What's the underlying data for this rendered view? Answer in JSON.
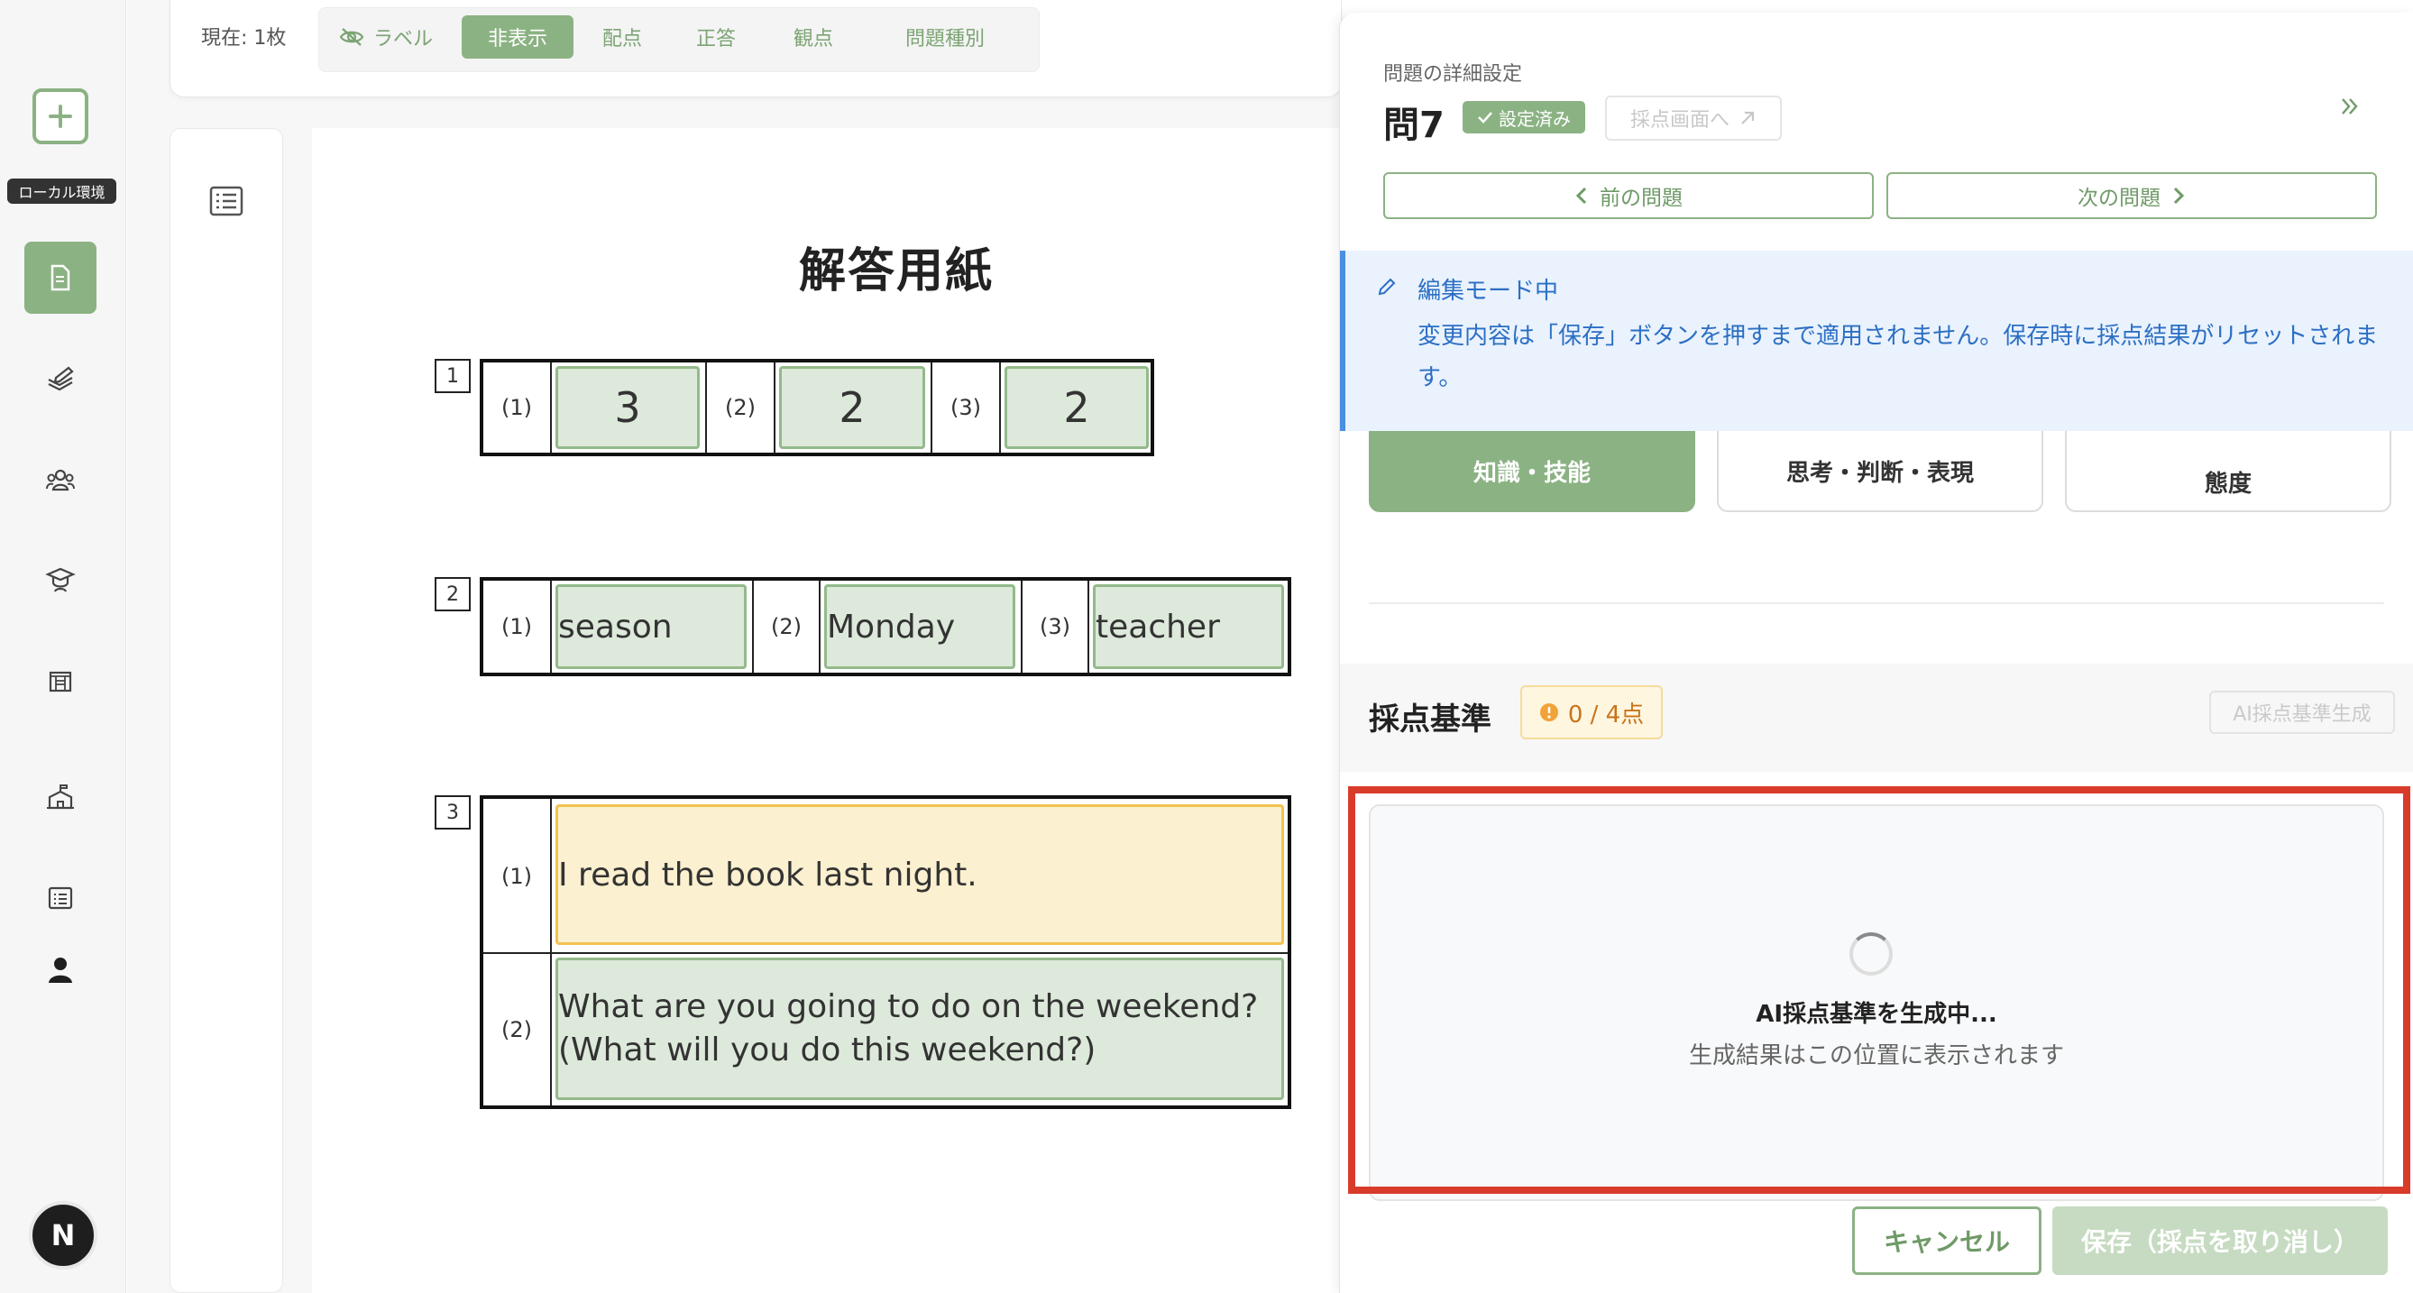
{
  "rail": {
    "environment_label": "ローカル環境",
    "avatar_letter": "N",
    "items": [
      {
        "icon": "document-icon",
        "active": true
      },
      {
        "icon": "pen-stack-icon",
        "active": false
      },
      {
        "icon": "people-icon",
        "active": false
      },
      {
        "icon": "graduation-icon",
        "active": false
      },
      {
        "icon": "book-icon",
        "active": false
      },
      {
        "icon": "school-icon",
        "active": false
      },
      {
        "icon": "list-icon",
        "active": false
      },
      {
        "icon": "person-icon",
        "active": false
      }
    ]
  },
  "toolbar": {
    "count": "現在: 1枚",
    "options": [
      {
        "label": "ラベル",
        "icon": "eye-off-icon"
      },
      {
        "label": "非表示",
        "selected": true
      },
      {
        "label": "配点"
      },
      {
        "label": "正答"
      },
      {
        "label": "観点"
      },
      {
        "label": "問題種別"
      }
    ]
  },
  "paper": {
    "title": "解答用紙",
    "q1": {
      "num": "1",
      "subs": [
        {
          "label": "(1)",
          "answer": "3"
        },
        {
          "label": "(2)",
          "answer": "2"
        },
        {
          "label": "(3)",
          "answer": "2"
        }
      ]
    },
    "q2": {
      "num": "2",
      "subs": [
        {
          "label": "(1)",
          "answer": "season"
        },
        {
          "label": "(2)",
          "answer": "Monday"
        },
        {
          "label": "(3)",
          "answer": "teacher"
        }
      ]
    },
    "q3": {
      "num": "3",
      "subs": [
        {
          "label": "(1)",
          "answer": "I read the book last night."
        },
        {
          "label": "(2)",
          "answer_line1": "What are you going to do on the weekend?",
          "answer_line2": "(What will you do this weekend?)"
        }
      ]
    }
  },
  "drawer": {
    "caption": "問題の詳細設定",
    "title": "問7",
    "status_badge": "設定済み",
    "grading_link": "採点画面へ",
    "prev_label": "前の問題",
    "next_label": "次の問題",
    "notice_title": "編集モード中",
    "notice_text": "変更内容は「保存」ボタンを押すまで適用されません。保存時に採点結果がリセットされます。",
    "viewpoints": [
      "知識・技能",
      "思考・判断・表現",
      "態度"
    ],
    "criteria_title": "採点基準",
    "criteria_score": "0 / 4点",
    "ai_generate_label": "AI採点基準生成",
    "generating_title": "AI採点基準を生成中...",
    "generating_sub": "生成結果はこの位置に表示されます",
    "cancel_label": "キャンセル",
    "save_label": "保存（採点を取り消し）"
  },
  "colors": {
    "accent": "#8bb283",
    "highlight": "#d93b2b",
    "notice": "#2c6fc4",
    "warning": "#c8741a"
  }
}
